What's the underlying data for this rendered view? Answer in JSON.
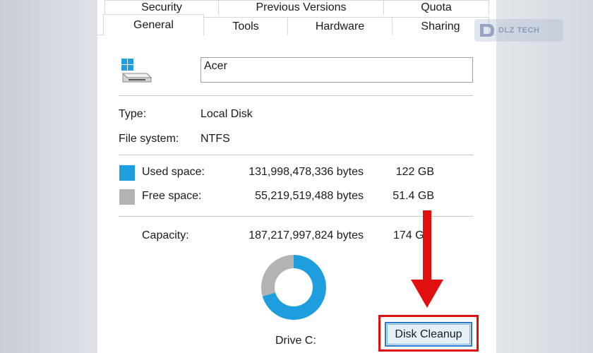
{
  "tabs": {
    "back": [
      "Security",
      "Previous Versions",
      "Quota"
    ],
    "front": [
      "General",
      "Tools",
      "Hardware",
      "Sharing"
    ],
    "active": "General"
  },
  "drive": {
    "icon": "windows-drive-icon",
    "name_value": "Acer"
  },
  "info": {
    "type_label": "Type:",
    "type_value": "Local Disk",
    "fs_label": "File system:",
    "fs_value": "NTFS"
  },
  "space": {
    "used_label": "Used space:",
    "used_bytes": "131,998,478,336 bytes",
    "used_size": "122 GB",
    "used_color": "#1e9ede",
    "free_label": "Free space:",
    "free_bytes": "55,219,519,488 bytes",
    "free_size": "51.4 GB",
    "free_color": "#b3b3b3",
    "capacity_label": "Capacity:",
    "capacity_bytes": "187,217,997,824 bytes",
    "capacity_size": "174 G",
    "used_fraction": 0.705
  },
  "chart_label": "Drive C:",
  "cleanup_button": "Disk Cleanup",
  "annotation": {
    "arrow_color": "#e01010"
  },
  "watermark": {
    "text": "DLZ TECH"
  }
}
